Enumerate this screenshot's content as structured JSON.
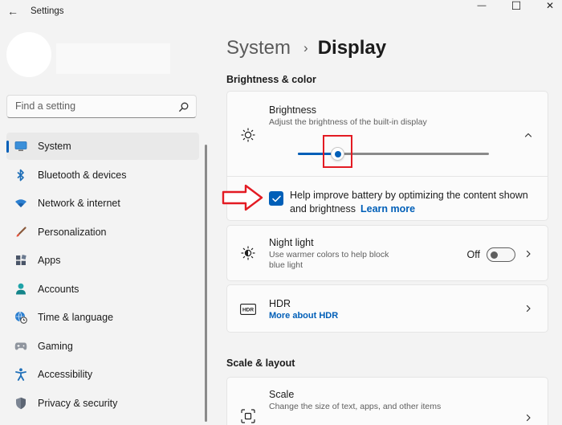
{
  "window": {
    "title": "Settings",
    "back_glyph": "←",
    "minimize_glyph": "—",
    "maximize_glyph": "☐",
    "close_glyph": "✕"
  },
  "search": {
    "placeholder": "Find a setting",
    "icon": "search-icon"
  },
  "sidebar": {
    "items": [
      {
        "label": "System",
        "icon": "monitor-icon",
        "active": true
      },
      {
        "label": "Bluetooth & devices",
        "icon": "bluetooth-icon"
      },
      {
        "label": "Network & internet",
        "icon": "wifi-icon"
      },
      {
        "label": "Personalization",
        "icon": "brush-icon"
      },
      {
        "label": "Apps",
        "icon": "apps-icon"
      },
      {
        "label": "Accounts",
        "icon": "person-icon"
      },
      {
        "label": "Time & language",
        "icon": "globe-clock-icon"
      },
      {
        "label": "Gaming",
        "icon": "gamepad-icon"
      },
      {
        "label": "Accessibility",
        "icon": "accessibility-icon"
      },
      {
        "label": "Privacy & security",
        "icon": "shield-icon"
      }
    ]
  },
  "breadcrumb": {
    "parent": "System",
    "separator": "›",
    "current": "Display"
  },
  "sections": {
    "brightness_color": "Brightness & color",
    "scale_layout": "Scale & layout"
  },
  "brightness": {
    "title": "Brightness",
    "description": "Adjust the brightness of the built-in display",
    "value_fraction": 0.21,
    "battery_checkbox": {
      "checked": true,
      "label": "Help improve battery by optimizing the content shown and brightness",
      "link": "Learn more"
    }
  },
  "night_light": {
    "title": "Night light",
    "description": "Use warmer colors to help block blue light",
    "toggle_state": "Off"
  },
  "hdr": {
    "title": "HDR",
    "link": "More about HDR",
    "icon_text": "HDR"
  },
  "scale": {
    "title": "Scale",
    "description": "Change the size of text, apps, and other items"
  },
  "colors": {
    "accent": "#005fb8",
    "annotation": "#e31b23",
    "background": "#f3f3f3",
    "card": "#fbfbfb"
  }
}
